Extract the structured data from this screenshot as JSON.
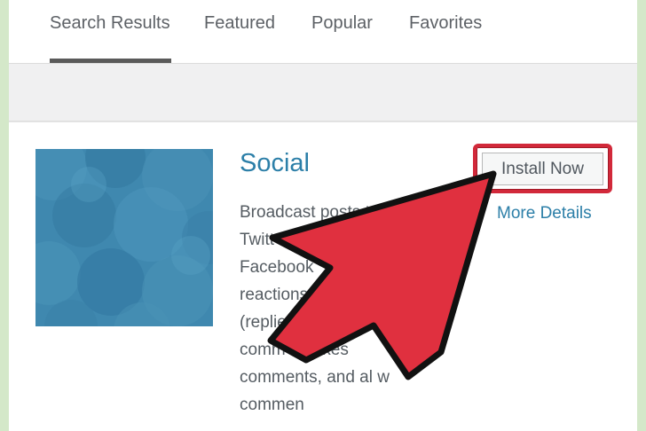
{
  "tabs": [
    {
      "label": "Search Results",
      "active": true
    },
    {
      "label": "Featured",
      "active": false
    },
    {
      "label": "Popular",
      "active": false
    },
    {
      "label": "Favorites",
      "active": false
    }
  ],
  "plugin": {
    "title": "Social",
    "install_label": "Install Now",
    "more_details_label": "More Details",
    "description_lines": [
      "Broadcast posts t",
      "Twitt",
      "Facebook",
      "reactions f",
      "(replie",
      "comm     \"likes",
      "comments, and al w",
      "commen"
    ]
  },
  "colors": {
    "page_bg": "#d4e8c9",
    "accent_link": "#2c7fa8",
    "highlight_red": "#d2293a",
    "thumbnail_blue": "#3d86ad"
  },
  "icons": {
    "pointer": "large-red-arrow-cursor-icon"
  }
}
